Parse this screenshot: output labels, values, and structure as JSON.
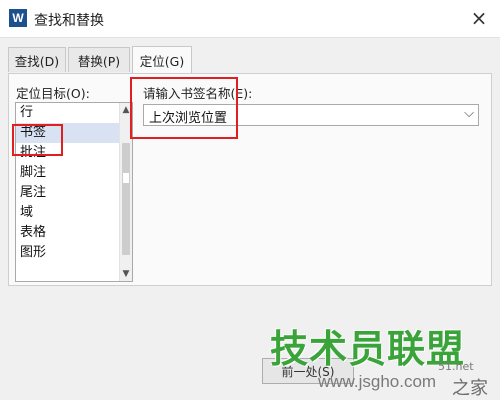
{
  "window": {
    "app_icon_letter": "W",
    "title": "查找和替换",
    "close_glyph": "×"
  },
  "tabs": [
    {
      "label": "查找(D)",
      "active": false
    },
    {
      "label": "替换(P)",
      "active": false
    },
    {
      "label": "定位(G)",
      "active": true
    }
  ],
  "goto": {
    "target_label": "定位目标(O):",
    "targets": [
      "行",
      "书签",
      "批注",
      "脚注",
      "尾注",
      "域",
      "表格",
      "图形"
    ],
    "selected_target": "书签",
    "name_label": "请输入书签名称(E):",
    "name_value": "上次浏览位置"
  },
  "footer": {
    "prev_button_partial": "前一处(S)"
  },
  "watermark": {
    "brand": "技术员联盟",
    "url": "www.jsgho.com",
    "fragment": "51.net",
    "tail": "之家"
  },
  "colors": {
    "highlight": "#e02020",
    "selection": "#d9e2f3",
    "watermark_green": "#3aa33a"
  }
}
